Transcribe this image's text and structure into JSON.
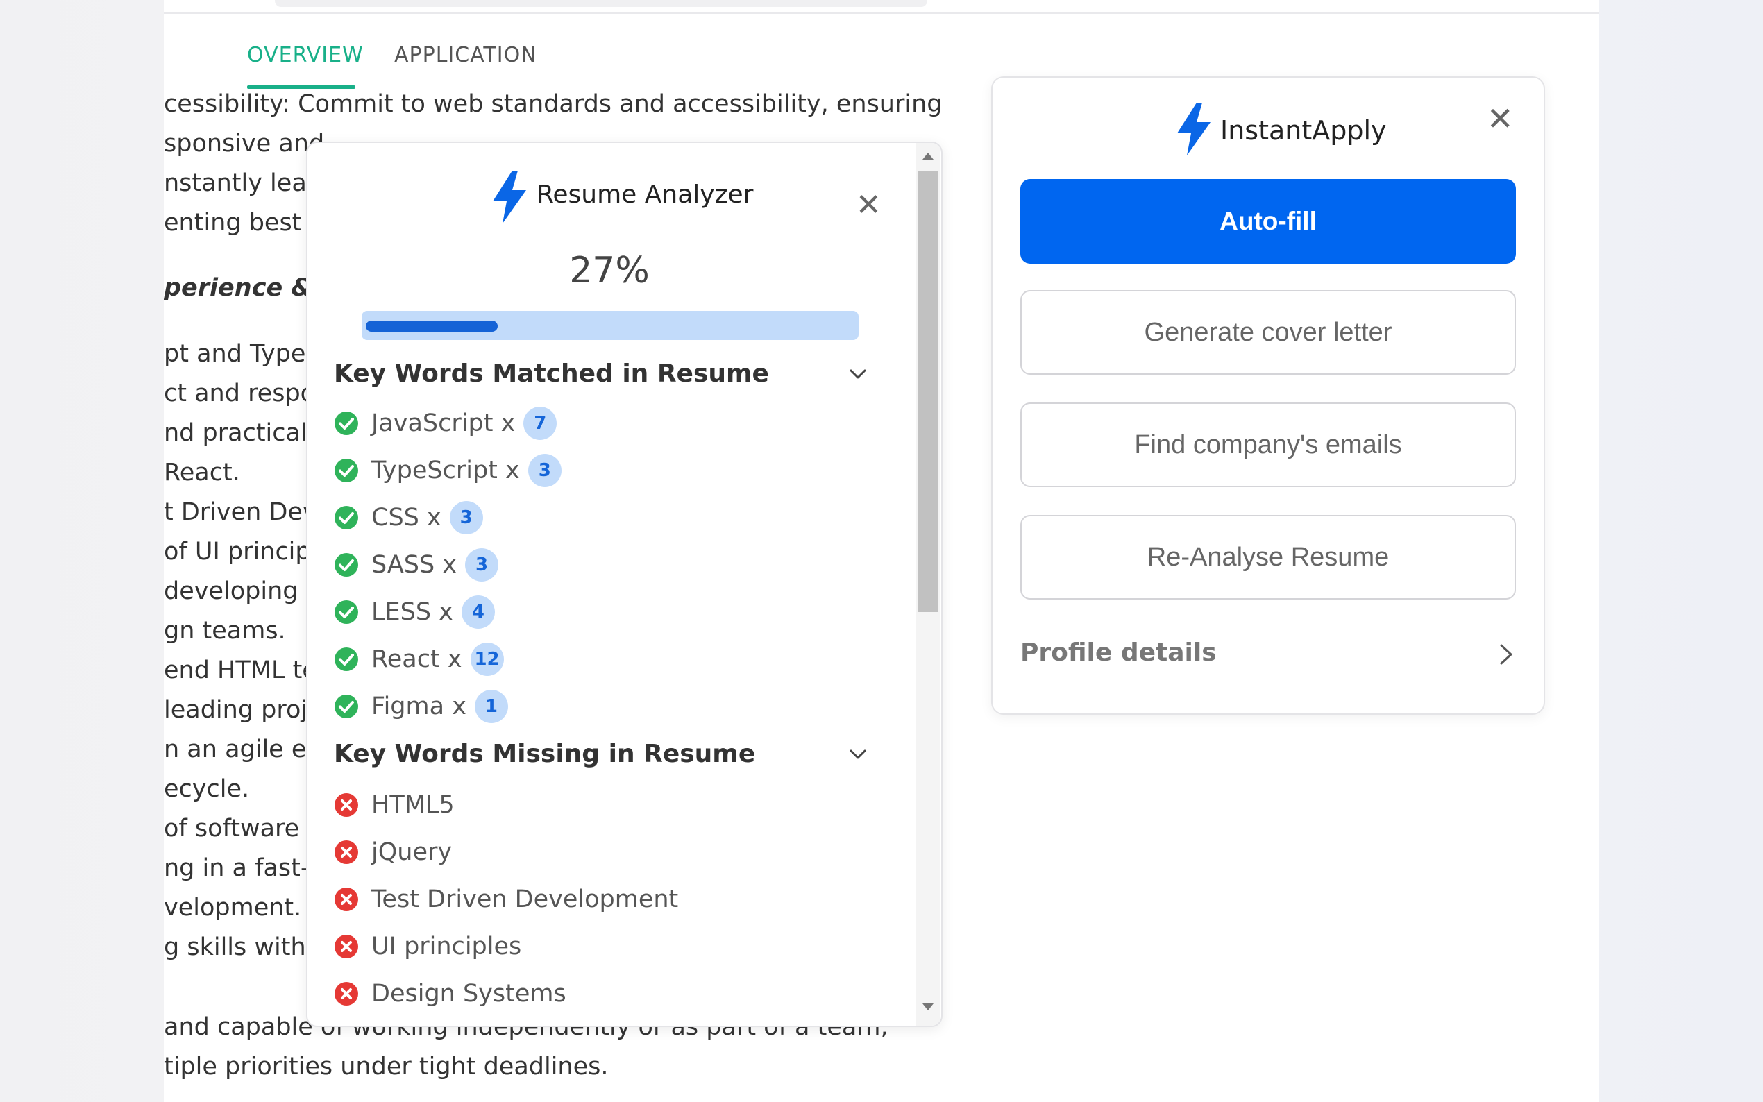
{
  "colors": {
    "accent_green": "#19b089",
    "primary_blue": "#0066f0",
    "bar_blue": "#1563d6",
    "bar_track": "#c2dbfa",
    "match_green": "#2fb35a",
    "missing_red": "#e53935"
  },
  "job_page": {
    "tabs": {
      "overview": "OVERVIEW",
      "application": "APPLICATION"
    },
    "lines": [
      "cessibility: Commit to web standards and accessibility, ensuring",
      "sponsive and",
      "nstantly learr",
      "enting best p",
      "perience & bo",
      "pt and TypeS",
      "ct and respo",
      "nd practical",
      "React.",
      "t Driven Dev",
      "of UI princip",
      "developing f",
      "gn teams.",
      "end HTML te",
      "leading proj",
      "n an agile er",
      "ecycle.",
      "of software",
      "ng in a fast-p",
      "velopment.",
      "g skills with",
      "",
      "and capable of working independently or as part of a team,",
      "tiple priorities under tight deadlines."
    ]
  },
  "analyzer": {
    "title": "Resume Analyzer",
    "logo_icon": "lightning-bolt-icon",
    "close_icon": "close-icon",
    "score": 27,
    "score_label": "27%",
    "matched_heading": "Key Words Matched in Resume",
    "missing_heading": "Key Words Missing in Resume",
    "matched": [
      {
        "label": "JavaScript x",
        "count": "7"
      },
      {
        "label": "TypeScript x",
        "count": "3"
      },
      {
        "label": "CSS x",
        "count": "3"
      },
      {
        "label": "SASS x",
        "count": "3"
      },
      {
        "label": "LESS x",
        "count": "4"
      },
      {
        "label": "React x",
        "count": "12"
      },
      {
        "label": "Figma x",
        "count": "1"
      }
    ],
    "missing": [
      "HTML5",
      "jQuery",
      "Test Driven Development",
      "UI principles",
      "Design Systems"
    ]
  },
  "instantapply": {
    "title": "InstantApply",
    "logo_icon": "lightning-bolt-icon",
    "close_icon": "close-icon",
    "autofill_label": "Auto-fill",
    "cover_label": "Generate cover letter",
    "emails_label": "Find company's emails",
    "reanalyse_label": "Re-Analyse Resume",
    "profile_label": "Profile details"
  }
}
